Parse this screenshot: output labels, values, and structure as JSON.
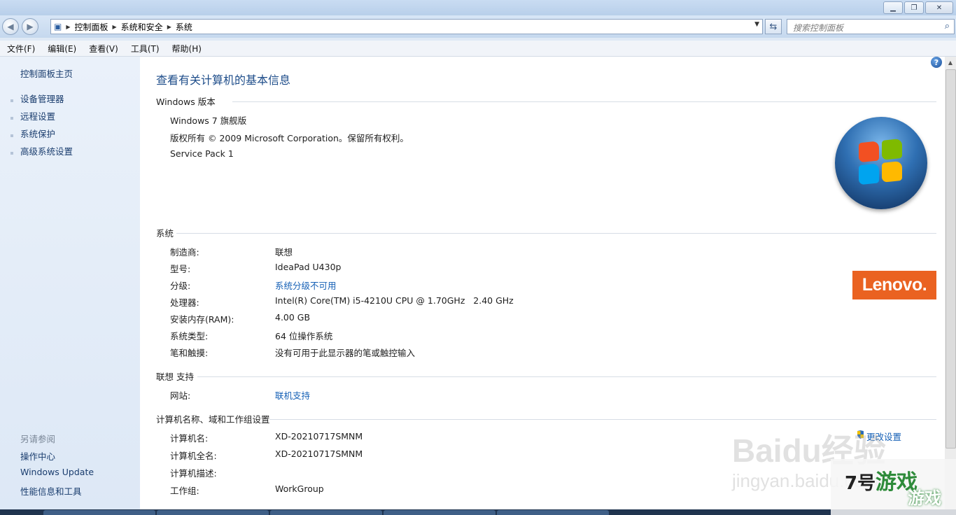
{
  "nav": {
    "crumbs": [
      "控制面板",
      "系统和安全",
      "系统"
    ],
    "search_placeholder": "搜索控制面板"
  },
  "menu": [
    "文件(F)",
    "编辑(E)",
    "查看(V)",
    "工具(T)",
    "帮助(H)"
  ],
  "sidebar": {
    "home": "控制面板主页",
    "links": [
      "设备管理器",
      "远程设置",
      "系统保护",
      "高级系统设置"
    ],
    "see_also_title": "另请参阅",
    "see_also": [
      "操作中心",
      "Windows Update",
      "性能信息和工具"
    ]
  },
  "page": {
    "heading": "查看有关计算机的基本信息",
    "edition_title": "Windows 版本",
    "edition": [
      "Windows 7 旗舰版",
      "版权所有 © 2009 Microsoft Corporation。保留所有权利。",
      "Service Pack 1"
    ],
    "system_title": "系统",
    "system": [
      {
        "label": "制造商:",
        "value": "联想"
      },
      {
        "label": "型号:",
        "value": "IdeaPad U430p"
      },
      {
        "label": "分级:",
        "value": "系统分级不可用"
      },
      {
        "label": "处理器:",
        "value": "Intel(R) Core(TM) i5-4210U CPU @ 1.70GHz   2.40 GHz"
      },
      {
        "label": "安装内存(RAM):",
        "value": "4.00 GB"
      },
      {
        "label": "系统类型:",
        "value": "64 位操作系统"
      },
      {
        "label": "笔和触摸:",
        "value": "没有可用于此显示器的笔或触控输入"
      }
    ],
    "support_title": "联想 支持",
    "support": [
      {
        "label": "网站:",
        "value": "联机支持"
      }
    ],
    "computer_title": "计算机名称、域和工作组设置",
    "computer": [
      {
        "label": "计算机名:",
        "value": "XD-20210717SMNM"
      },
      {
        "label": "计算机全名:",
        "value": "XD-20210717SMNM"
      },
      {
        "label": "计算机描述:",
        "value": ""
      },
      {
        "label": "工作组:",
        "value": "WorkGroup"
      }
    ],
    "change_settings": "更改设置",
    "lenovo_logo": "Lenovo."
  },
  "watermark": {
    "line1": "Baidu经验",
    "line2": "jingyan.baidu.com",
    "corner_a": "7号",
    "corner_b": "游戏",
    "corner_c": "游戏"
  },
  "colors": {
    "link": "#1560b6",
    "heading": "#1e4d8a",
    "lenovo": "#ea6221"
  }
}
